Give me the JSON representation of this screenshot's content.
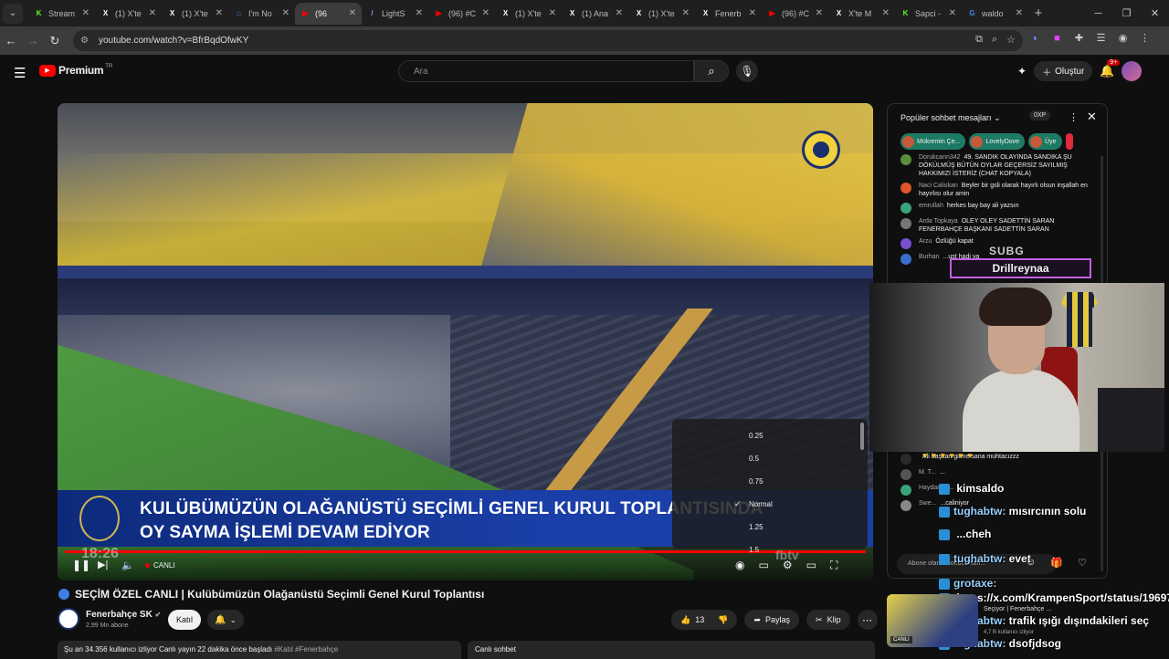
{
  "browser": {
    "tabs": [
      {
        "title": "Stream",
        "fav": "K",
        "color": "#53fc18"
      },
      {
        "title": "(1) X'te",
        "fav": "X",
        "color": "#ffffff"
      },
      {
        "title": "(1) X'te",
        "fav": "X",
        "color": "#ffffff"
      },
      {
        "title": "I'm No",
        "fav": "⌂",
        "color": "#4a8ff0"
      },
      {
        "title": "(96",
        "fav": "▶",
        "color": "#ff0000"
      },
      {
        "title": "LightS",
        "fav": "/",
        "color": "#b47cff"
      },
      {
        "title": "(96) #C",
        "fav": "▶",
        "color": "#ff0000"
      },
      {
        "title": "(1) X'te",
        "fav": "X",
        "color": "#ffffff"
      },
      {
        "title": "(1) Ana",
        "fav": "X",
        "color": "#ffffff"
      },
      {
        "title": "(1) X'te",
        "fav": "X",
        "color": "#ffffff"
      },
      {
        "title": "Fenerb",
        "fav": "X",
        "color": "#ffffff"
      },
      {
        "title": "(96) #C",
        "fav": "▶",
        "color": "#ff0000"
      },
      {
        "title": "X'te M",
        "fav": "X",
        "color": "#ffffff"
      },
      {
        "title": "Sapci -",
        "fav": "K",
        "color": "#53fc18"
      },
      {
        "title": "waldo",
        "fav": "G",
        "color": "#4285f4"
      }
    ],
    "active_tab_index": 4,
    "url": "youtube.com/watch?v=BfrBqdOfwKY"
  },
  "youtube": {
    "brand": "Premium",
    "country": "TR",
    "search_placeholder": "Ara",
    "create_label": "Oluştur",
    "notif_count": "9+"
  },
  "video": {
    "banner_line1": "KULÜBÜMÜZÜN OLAĞANÜSTÜ SEÇİMLİ GENEL KURUL TOPLANTISINDA",
    "banner_line2": "OY SAYMA İŞLEMİ DEVAM EDİYOR",
    "time": "18:26",
    "live_label": "CANLI",
    "watermark": "fbtv",
    "speed_options": [
      {
        "label": "0.25",
        "selected": false
      },
      {
        "label": "0.5",
        "selected": false
      },
      {
        "label": "0.75",
        "selected": false
      },
      {
        "label": "Normal",
        "selected": true
      },
      {
        "label": "1.25",
        "selected": false
      },
      {
        "label": "1.5",
        "selected": false
      }
    ]
  },
  "meta": {
    "title": "SEÇİM ÖZEL CANLI | Kulübümüzün Olağanüstü Seçimli Genel Kurul Toplantısı",
    "channel": "Fenerbahçe SK",
    "subscribers": "2,99 Mn abone",
    "join_label": "Katıl",
    "likes": "13",
    "share_label": "Paylaş",
    "clip_label": "Klip",
    "description_lead": "Şu an 34.356 kullanıcı izliyor  Canlı yayın 22 dakika önce başladı ",
    "description_tags": "#Katıl #Fenerbahçe",
    "live_chat_label": "Canlı sohbet"
  },
  "chat": {
    "header": "Popüler sohbet mesajları",
    "xp": "0XP",
    "pinned": [
      {
        "name": "Mükremin Çe..."
      },
      {
        "name": "LovelyDove"
      },
      {
        "name": "Üye"
      }
    ],
    "messages": [
      {
        "user": "Dorukcann342",
        "text": "49. SANDIK OLAYINDA SANDIKA ŞU DÖKÜLMÜŞ BÜTÜN OYLAR GEÇERSİZ SAYILMIŞ HAKKIMIZI İSTERİZ (CHAT KOPYALA)",
        "color": "#5a8f3a"
      },
      {
        "user": "Naci Caliskan",
        "text": "Beyler bir gsli olarak hayırlı olsun inşallah en hayırlısı olur amin",
        "color": "#e0562a"
      },
      {
        "user": "emrullah",
        "text": "herkes bay bay ali yazsın",
        "color": "#3aa37a"
      },
      {
        "user": "Arda Topkaya",
        "text": "OLEY OLEY SADETTİN SARAN FENERBAHÇE BAŞKANI SADETTİN SARAN",
        "color": "#777777"
      },
      {
        "user": "Arzu",
        "text": "Özlüğü kapat",
        "color": "#7a4fd0"
      },
      {
        "user": "Burhan",
        "text": "...ust hadi ya",
        "color": "#3a6fd0"
      }
    ],
    "bottom_messages": [
      {
        "user": "",
        "text": "Ali başkan gitme sana muhtacızzz",
        "color": "#2a2a2a"
      },
      {
        "user": "M. T...",
        "text": "...",
        "color": "#555555"
      },
      {
        "user": "Haydar...",
        "text": "...",
        "color": "#3aa37a"
      },
      {
        "user": "Swe...",
        "text": "...caliniyor",
        "color": "#888888"
      }
    ],
    "input_placeholder": "Abone olarak sohbet edin..."
  },
  "overlay": {
    "sub_text": "SUBG",
    "name_box": "Drillreynaa",
    "chats": [
      {
        "user": "",
        "text": "kimsaldo"
      },
      {
        "user": "tughabtw:",
        "text": "mısırcının solu"
      },
      {
        "user": "",
        "text": "...cheh"
      },
      {
        "user": "tughabtw:",
        "text": "evet"
      },
      {
        "user": "grotaxe:",
        "text": ""
      },
      {
        "user": "",
        "text": "https://x.com/KrampenSport/status/19697845"
      },
      {
        "user": "tughabtw:",
        "text": "trafik ışığı dışındakileri seç"
      },
      {
        "user": "tughabtw:",
        "text": "dsofjdsog"
      }
    ]
  },
  "recommended": {
    "title": "Seçiyor | Fenerbahçe ...",
    "meta": "4,7 B kullanıcı izliyor",
    "badge": "CANLI"
  }
}
